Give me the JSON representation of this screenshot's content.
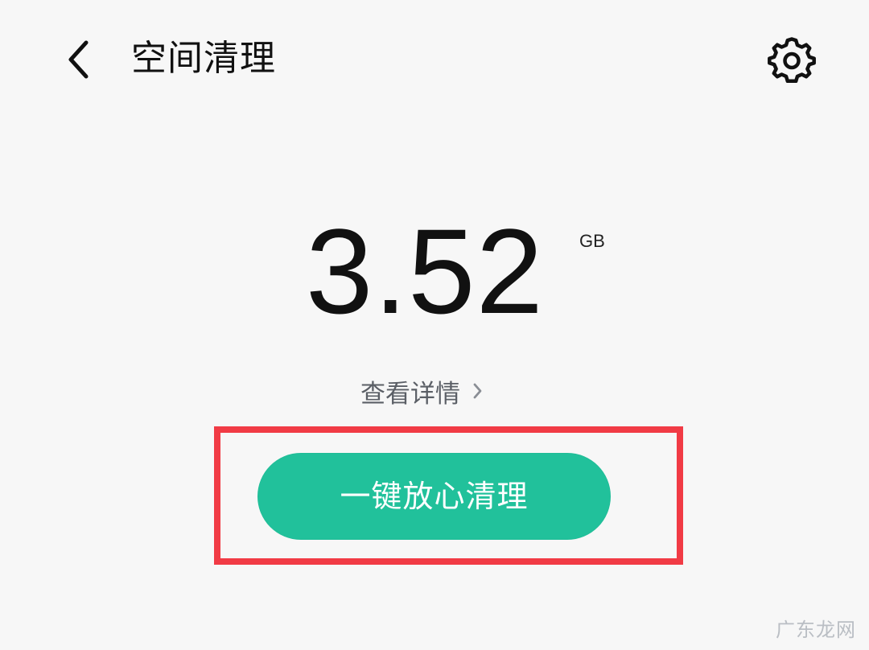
{
  "header": {
    "title": "空间清理",
    "back_icon": "chevron-left-icon",
    "settings_icon": "gear-icon"
  },
  "summary": {
    "value": "3.52",
    "unit": "GB",
    "details_label": "查看详情",
    "details_icon": "chevron-right-icon"
  },
  "actions": {
    "clean_label": "一键放心清理",
    "button_color": "#21C19B",
    "highlight_color": "#F13B45"
  },
  "watermark": {
    "text": "广东龙网"
  }
}
